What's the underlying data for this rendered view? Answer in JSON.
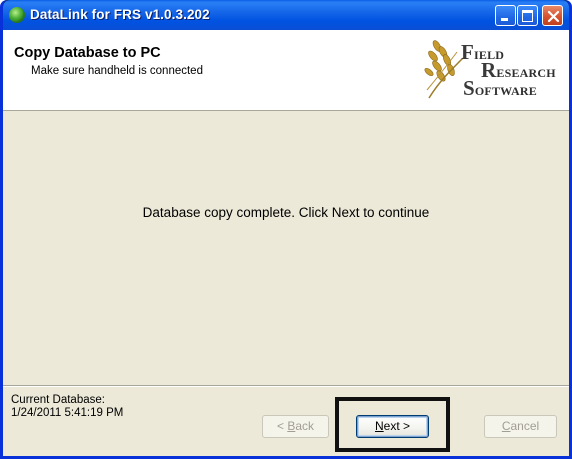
{
  "window": {
    "title": "DataLink for FRS v1.0.3.202",
    "icons": [
      "app-icon",
      "minimize-icon",
      "maximize-icon",
      "close-icon"
    ]
  },
  "header": {
    "title": "Copy Database to PC",
    "subtitle": "Make sure handheld is connected",
    "logo": {
      "line1_big": "F",
      "line1_small": "IELD",
      "line2_big": "R",
      "line2_small": "ESEARCH",
      "line3_big": "S",
      "line3_small": "OFTWARE"
    }
  },
  "main": {
    "message": "Database copy complete. Click Next to continue"
  },
  "footer": {
    "current_label": "Current Database:",
    "current_value": "1/24/2011 5:41:19 PM",
    "buttons": {
      "back": {
        "prefix": "< ",
        "mnemonic": "B",
        "rest": "ack",
        "enabled": false
      },
      "next": {
        "mnemonic": "N",
        "rest": "ext >",
        "enabled": true
      },
      "cancel": {
        "mnemonic": "C",
        "rest": "ancel",
        "enabled": false
      }
    }
  },
  "colors": {
    "titlebar": "#0053e1",
    "client_bg": "#ece9d8",
    "highlight_box": "#111111"
  }
}
